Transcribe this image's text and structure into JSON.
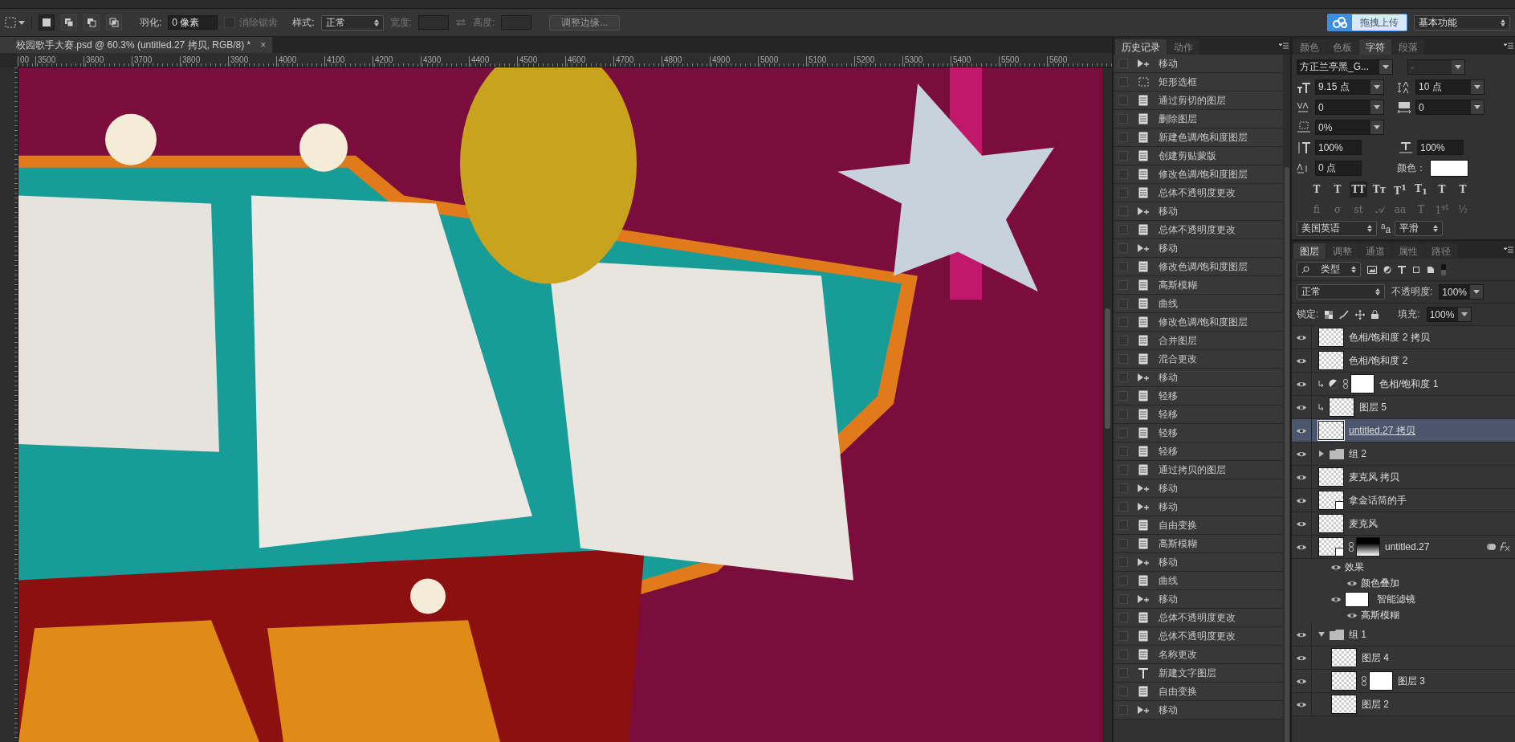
{
  "options_bar": {
    "selection_modes": [
      {
        "selected": true
      },
      {
        "selected": false
      },
      {
        "selected": false
      },
      {
        "selected": false
      }
    ],
    "feather_label": "羽化:",
    "feather_value": "0 像素",
    "antialias": {
      "label": "消除锯齿",
      "checked": false,
      "disabled": true
    },
    "style_label": "样式:",
    "style_value": "正常",
    "width_label": "宽度:",
    "height_label": "高度:",
    "refine_button": "调整边缘...",
    "upload_button": "拖拽上传",
    "workspace": "基本功能"
  },
  "document": {
    "tab_title": "校园歌手大赛.psd @ 60.3% (untitled.27 拷贝, RGB/8) *",
    "close": "×",
    "ruler_labels": [
      "00",
      "3500",
      "3600",
      "3700",
      "3800",
      "3900",
      "4000",
      "4100",
      "4200",
      "4300",
      "4400",
      "4500",
      "4600",
      "4700",
      "4800",
      "4900",
      "5000",
      "5100",
      "5200",
      "5300",
      "5400",
      "5500",
      "5600"
    ]
  },
  "history": {
    "tabs": [
      {
        "label": "历史记录",
        "selected": true
      },
      {
        "label": "动作",
        "selected": false
      }
    ],
    "items": [
      {
        "kind": "move",
        "label": "移动"
      },
      {
        "kind": "marquee",
        "label": "矩形选框"
      },
      {
        "kind": "doc",
        "label": "通过剪切的图层"
      },
      {
        "kind": "doc",
        "label": "删除图层"
      },
      {
        "kind": "doc",
        "label": "新建色调/饱和度图层"
      },
      {
        "kind": "doc",
        "label": "创建剪贴蒙版"
      },
      {
        "kind": "doc",
        "label": "修改色调/饱和度图层"
      },
      {
        "kind": "doc",
        "label": "总体不透明度更改"
      },
      {
        "kind": "move",
        "label": "移动"
      },
      {
        "kind": "doc",
        "label": "总体不透明度更改"
      },
      {
        "kind": "move",
        "label": "移动"
      },
      {
        "kind": "doc",
        "label": "修改色调/饱和度图层"
      },
      {
        "kind": "doc",
        "label": "高斯模糊"
      },
      {
        "kind": "doc",
        "label": "曲线"
      },
      {
        "kind": "doc",
        "label": "修改色调/饱和度图层"
      },
      {
        "kind": "doc",
        "label": "合并图层"
      },
      {
        "kind": "doc",
        "label": "混合更改"
      },
      {
        "kind": "move",
        "label": "移动"
      },
      {
        "kind": "doc",
        "label": "轻移"
      },
      {
        "kind": "doc",
        "label": "轻移"
      },
      {
        "kind": "doc",
        "label": "轻移"
      },
      {
        "kind": "doc",
        "label": "轻移"
      },
      {
        "kind": "doc",
        "label": "通过拷贝的图层"
      },
      {
        "kind": "move",
        "label": "移动"
      },
      {
        "kind": "move",
        "label": "移动"
      },
      {
        "kind": "doc",
        "label": "自由变换"
      },
      {
        "kind": "doc",
        "label": "高斯模糊"
      },
      {
        "kind": "move",
        "label": "移动"
      },
      {
        "kind": "doc",
        "label": "曲线"
      },
      {
        "kind": "move",
        "label": "移动"
      },
      {
        "kind": "doc",
        "label": "总体不透明度更改"
      },
      {
        "kind": "doc",
        "label": "总体不透明度更改"
      },
      {
        "kind": "doc",
        "label": "名称更改"
      },
      {
        "kind": "text",
        "label": "新建文字图层"
      },
      {
        "kind": "doc",
        "label": "自由变换"
      },
      {
        "kind": "move",
        "label": "移动"
      }
    ]
  },
  "character": {
    "tabs": [
      {
        "label": "颜色",
        "selected": false
      },
      {
        "label": "色板",
        "selected": false
      },
      {
        "label": "字符",
        "selected": true
      },
      {
        "label": "段落",
        "selected": false
      }
    ],
    "font_family": "方正兰亭黑_G...",
    "font_style": "-",
    "size": "9.15 点",
    "leading": "10 点",
    "kerning": "0",
    "tracking": "0",
    "tsume": "0%",
    "vertical_scale": "100%",
    "horizontal_scale": "100%",
    "baseline_shift": "0 点",
    "color_label": "颜色：",
    "color": "#ffffff",
    "style_buttons": [
      {
        "label": "T",
        "selected": false
      },
      {
        "label": "T",
        "selected": false
      },
      {
        "label": "TT",
        "selected": true
      },
      {
        "label": "Tт",
        "selected": false
      },
      {
        "label": "T$^{1}$",
        "selected": false
      },
      {
        "label": "T$_{1}$",
        "selected": false
      },
      {
        "label": "T",
        "selected": false
      },
      {
        "label": "T",
        "selected": false
      }
    ],
    "opentype_buttons": [
      "ﬁ",
      "σ",
      "st",
      "𝒜",
      "aa",
      "T",
      "1$^{st}$",
      "½"
    ],
    "language": "美国英语",
    "antialias_label": "$^{a}$a",
    "antialias": "平滑"
  },
  "layers": {
    "tabs": [
      {
        "label": "图层",
        "selected": true
      },
      {
        "label": "调整",
        "selected": false
      },
      {
        "label": "通道",
        "selected": false
      },
      {
        "label": "属性",
        "selected": false
      },
      {
        "label": "路径",
        "selected": false
      }
    ],
    "filter": "类型",
    "blend_mode": "正常",
    "opacity_label": "不透明度:",
    "opacity": "100%",
    "lock_label": "锁定:",
    "fill_label": "填充:",
    "fill": "100%",
    "items": [
      {
        "kind": "pixel",
        "name": "色相/饱和度 2 拷贝",
        "visible": true,
        "selected": false
      },
      {
        "kind": "pixel",
        "name": "色相/饱和度 2",
        "visible": true,
        "selected": false
      },
      {
        "kind": "adjustment",
        "name": "色相/饱和度 1",
        "visible": true,
        "selected": false,
        "clipped": true,
        "mask": true
      },
      {
        "kind": "pixel",
        "name": "图层 5",
        "visible": true,
        "selected": false,
        "clipped": true
      },
      {
        "kind": "pixel",
        "name": "untitled.27 拷贝",
        "visible": true,
        "selected": true
      },
      {
        "kind": "group",
        "name": "组 2",
        "visible": true,
        "selected": false,
        "expanded": false
      },
      {
        "kind": "pixel",
        "name": "麦克风 拷贝",
        "visible": true,
        "selected": false
      },
      {
        "kind": "smart",
        "name": "拿金话筒的手",
        "visible": true,
        "selected": false
      },
      {
        "kind": "pixel",
        "name": "麦克风",
        "visible": true,
        "selected": false
      },
      {
        "kind": "smart",
        "name": "untitled.27",
        "visible": true,
        "selected": false,
        "mask": true,
        "fx": true,
        "sub_rows": [
          {
            "kind": "header",
            "label": "效果"
          },
          {
            "kind": "effect",
            "label": "颜色叠加"
          },
          {
            "kind": "filter",
            "label": "智能滤镜"
          },
          {
            "kind": "effect",
            "label": "高斯模糊"
          }
        ]
      },
      {
        "kind": "group",
        "name": "组 1",
        "visible": true,
        "selected": false,
        "expanded": true,
        "children": [
          {
            "kind": "pixel",
            "name": "图层 4",
            "visible": true,
            "selected": false
          },
          {
            "kind": "pixel",
            "name": "图层 3",
            "visible": true,
            "selected": false,
            "mask": true
          },
          {
            "kind": "pixel",
            "name": "图层 2",
            "visible": true,
            "selected": false
          }
        ]
      }
    ]
  }
}
